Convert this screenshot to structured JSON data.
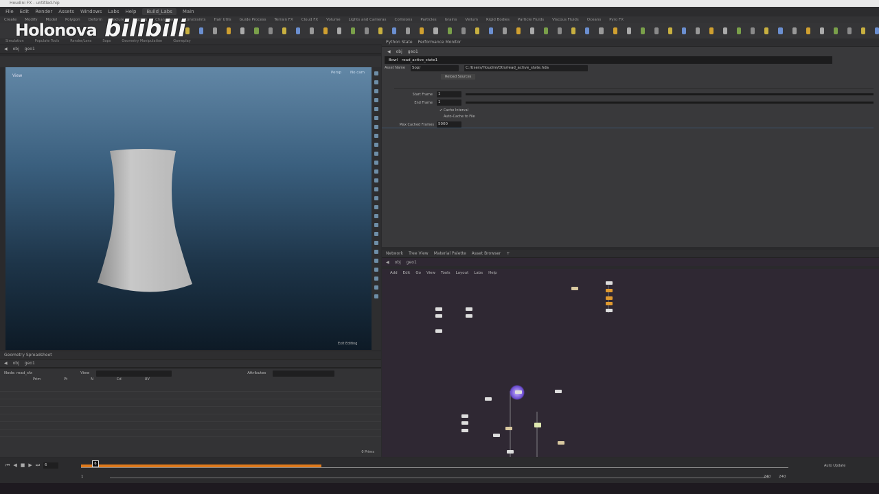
{
  "titlebar": {
    "text": "Houdini FX - untitled.hip"
  },
  "menu": [
    "File",
    "Edit",
    "Render",
    "Assets",
    "Windows",
    "Labs",
    "Help"
  ],
  "desktop": "Build_Labs",
  "desktop2": "Main",
  "shelf_tabs": [
    "Create",
    "Modify",
    "Model",
    "Polygon",
    "Deform",
    "Texture",
    "Rigging",
    "Characters",
    "Constraints",
    "Hair Utils",
    "Guide Process",
    "Terrain FX",
    "Cloud FX",
    "Volume",
    "Lights and Cameras",
    "Collisions",
    "Particles",
    "Grains",
    "Vellum",
    "Rigid Bodies",
    "Particle Fluids",
    "Viscous Fluids",
    "Oceans",
    "Pyro FX"
  ],
  "shelf_row2": [
    "Simulation",
    "Populate Tools",
    "Render/Lens",
    "Sops",
    "Geometry Manipulation",
    "Gameplay"
  ],
  "watermark": {
    "brand": "Holonova",
    "site": "bilibili"
  },
  "viewport": {
    "path": [
      "obj",
      "geo1"
    ],
    "label": "View",
    "persp": "Persp",
    "cam": "No cam",
    "footer": "Exit Editing"
  },
  "spreadsheet": {
    "tab": "Geometry Spreadsheet",
    "path": [
      "obj",
      "geo1"
    ],
    "node": "Node: read_sfx",
    "columns": [
      "Prim",
      "Pt",
      "N",
      "Cd",
      "UV"
    ],
    "view_label": "View",
    "attr_label": "Attributes",
    "footer": "0 Prims"
  },
  "params": {
    "tabs": [
      "Python State",
      "Performance Monitor"
    ],
    "path": [
      "obj",
      "geo1"
    ],
    "node_type": "Bowl",
    "node_name": "read_active_state1",
    "asset_label": "Asset Name",
    "asset_value": "Sop/",
    "asset_path": "C:/Users/Houdini/Otls/read_active_state.hda",
    "button": "Reload Sources",
    "start_label": "Start Frame",
    "start_value": "1",
    "end_label": "End Frame",
    "end_value": "1",
    "check1": "Cache Interval",
    "check2": "Auto-Cache to File",
    "maxframes_label": "Max Cached Frames",
    "maxframes_value": "5000"
  },
  "network": {
    "tabs": [
      "Network",
      "Tree View",
      "Material Palette",
      "Asset Browser"
    ],
    "path": [
      "obj",
      "geo1"
    ],
    "menu": [
      "Add",
      "Edit",
      "Go",
      "View",
      "Tools",
      "Layout",
      "Labs",
      "Help"
    ]
  },
  "timeline": {
    "frame": "6",
    "start": "1",
    "end": "240",
    "range_end": "240",
    "realtime": "Auto Update"
  },
  "colors": {
    "accent": "#e07a1c",
    "viewport_top": "#6287a6",
    "viewport_bottom": "#0d1a26"
  }
}
